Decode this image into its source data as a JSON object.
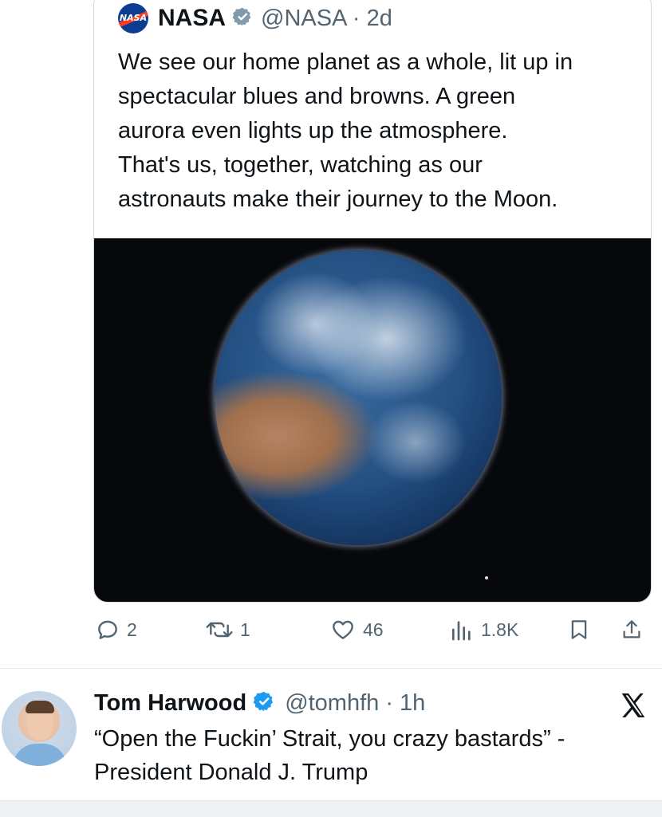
{
  "quoted_tweet": {
    "logo_text": "NASA",
    "name": "NASA",
    "handle_time": "@NASA · 2d",
    "text": "We see our home planet as a whole, lit up in\nspectacular blues and browns. A green\naurora even lights up the atmosphere.\nThat's us, together, watching as our\nastronauts make their journey to the Moon."
  },
  "actions": {
    "replies": "2",
    "reposts": "1",
    "likes": "46",
    "views": "1.8K"
  },
  "post": {
    "name": "Tom Harwood",
    "handle_time": "@tomhfh · 1h",
    "text": "“Open the Fuckin’ Strait, you crazy bastards” -\nPresident Donald J. Trump"
  },
  "colors": {
    "verified_badge": "#1d9bf0",
    "gray_badge": "#829aab",
    "secondary_text": "#536471"
  }
}
